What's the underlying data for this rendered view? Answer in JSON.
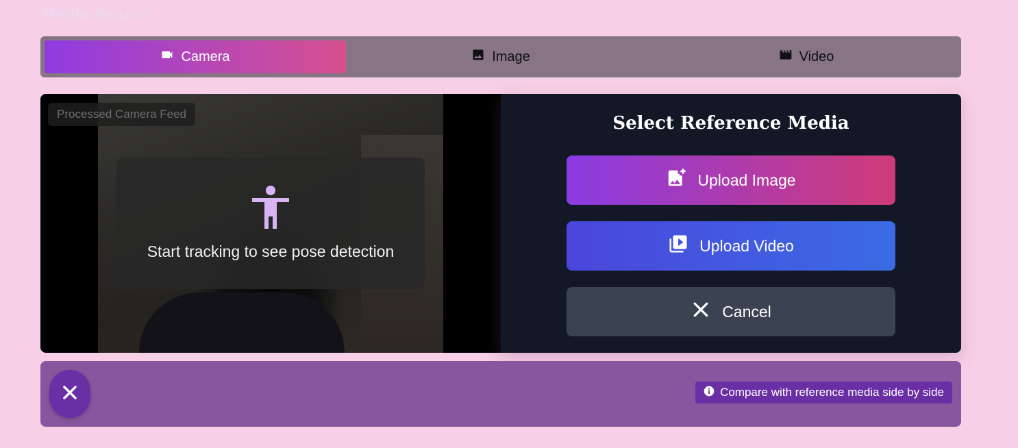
{
  "section": {
    "title": "Media Source"
  },
  "tabs": [
    {
      "label": "Camera",
      "icon": "videocam-icon",
      "active": true
    },
    {
      "label": "Image",
      "icon": "image-icon",
      "active": false
    },
    {
      "label": "Video",
      "icon": "movie-icon",
      "active": false
    }
  ],
  "feed": {
    "label": "Processed Camera Feed",
    "overlay_message": "Start tracking to see pose detection",
    "overlay_icon": "accessibility-person-icon"
  },
  "reference": {
    "title": "Select Reference Media",
    "upload_image_label": "Upload Image",
    "upload_video_label": "Upload Video",
    "cancel_label": "Cancel"
  },
  "bottom": {
    "close_icon": "close-icon",
    "info_text": "Compare with reference media side by side"
  },
  "colors": {
    "page_background": "#f7cfe6",
    "accent_gradient_start": "#8f3be2",
    "accent_gradient_end": "#d7508f",
    "video_button": "#4b46db",
    "panel_background": "#121826",
    "bottom_bar": "#87569e",
    "chip": "#6a2fa5"
  }
}
